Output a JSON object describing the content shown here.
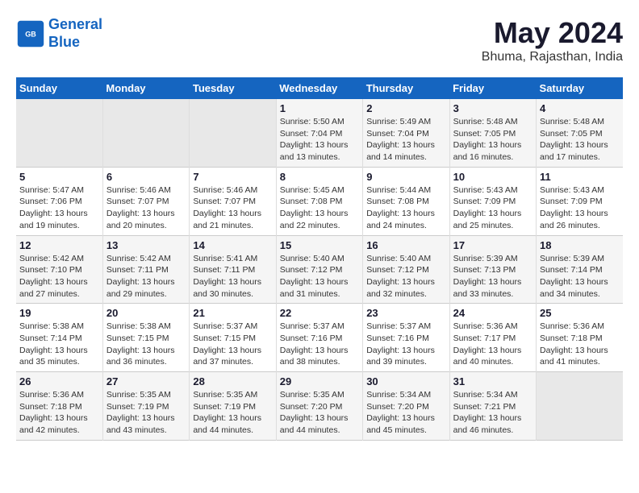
{
  "header": {
    "logo_line1": "General",
    "logo_line2": "Blue",
    "month_year": "May 2024",
    "location": "Bhuma, Rajasthan, India"
  },
  "weekdays": [
    "Sunday",
    "Monday",
    "Tuesday",
    "Wednesday",
    "Thursday",
    "Friday",
    "Saturday"
  ],
  "weeks": [
    [
      {
        "day": "",
        "empty": true
      },
      {
        "day": "",
        "empty": true
      },
      {
        "day": "",
        "empty": true
      },
      {
        "day": "1",
        "sunrise": "5:50 AM",
        "sunset": "7:04 PM",
        "daylight": "13 hours and 13 minutes."
      },
      {
        "day": "2",
        "sunrise": "5:49 AM",
        "sunset": "7:04 PM",
        "daylight": "13 hours and 14 minutes."
      },
      {
        "day": "3",
        "sunrise": "5:48 AM",
        "sunset": "7:05 PM",
        "daylight": "13 hours and 16 minutes."
      },
      {
        "day": "4",
        "sunrise": "5:48 AM",
        "sunset": "7:05 PM",
        "daylight": "13 hours and 17 minutes."
      }
    ],
    [
      {
        "day": "5",
        "sunrise": "5:47 AM",
        "sunset": "7:06 PM",
        "daylight": "13 hours and 19 minutes."
      },
      {
        "day": "6",
        "sunrise": "5:46 AM",
        "sunset": "7:07 PM",
        "daylight": "13 hours and 20 minutes."
      },
      {
        "day": "7",
        "sunrise": "5:46 AM",
        "sunset": "7:07 PM",
        "daylight": "13 hours and 21 minutes."
      },
      {
        "day": "8",
        "sunrise": "5:45 AM",
        "sunset": "7:08 PM",
        "daylight": "13 hours and 22 minutes."
      },
      {
        "day": "9",
        "sunrise": "5:44 AM",
        "sunset": "7:08 PM",
        "daylight": "13 hours and 24 minutes."
      },
      {
        "day": "10",
        "sunrise": "5:43 AM",
        "sunset": "7:09 PM",
        "daylight": "13 hours and 25 minutes."
      },
      {
        "day": "11",
        "sunrise": "5:43 AM",
        "sunset": "7:09 PM",
        "daylight": "13 hours and 26 minutes."
      }
    ],
    [
      {
        "day": "12",
        "sunrise": "5:42 AM",
        "sunset": "7:10 PM",
        "daylight": "13 hours and 27 minutes."
      },
      {
        "day": "13",
        "sunrise": "5:42 AM",
        "sunset": "7:11 PM",
        "daylight": "13 hours and 29 minutes."
      },
      {
        "day": "14",
        "sunrise": "5:41 AM",
        "sunset": "7:11 PM",
        "daylight": "13 hours and 30 minutes."
      },
      {
        "day": "15",
        "sunrise": "5:40 AM",
        "sunset": "7:12 PM",
        "daylight": "13 hours and 31 minutes."
      },
      {
        "day": "16",
        "sunrise": "5:40 AM",
        "sunset": "7:12 PM",
        "daylight": "13 hours and 32 minutes."
      },
      {
        "day": "17",
        "sunrise": "5:39 AM",
        "sunset": "7:13 PM",
        "daylight": "13 hours and 33 minutes."
      },
      {
        "day": "18",
        "sunrise": "5:39 AM",
        "sunset": "7:14 PM",
        "daylight": "13 hours and 34 minutes."
      }
    ],
    [
      {
        "day": "19",
        "sunrise": "5:38 AM",
        "sunset": "7:14 PM",
        "daylight": "13 hours and 35 minutes."
      },
      {
        "day": "20",
        "sunrise": "5:38 AM",
        "sunset": "7:15 PM",
        "daylight": "13 hours and 36 minutes."
      },
      {
        "day": "21",
        "sunrise": "5:37 AM",
        "sunset": "7:15 PM",
        "daylight": "13 hours and 37 minutes."
      },
      {
        "day": "22",
        "sunrise": "5:37 AM",
        "sunset": "7:16 PM",
        "daylight": "13 hours and 38 minutes."
      },
      {
        "day": "23",
        "sunrise": "5:37 AM",
        "sunset": "7:16 PM",
        "daylight": "13 hours and 39 minutes."
      },
      {
        "day": "24",
        "sunrise": "5:36 AM",
        "sunset": "7:17 PM",
        "daylight": "13 hours and 40 minutes."
      },
      {
        "day": "25",
        "sunrise": "5:36 AM",
        "sunset": "7:18 PM",
        "daylight": "13 hours and 41 minutes."
      }
    ],
    [
      {
        "day": "26",
        "sunrise": "5:36 AM",
        "sunset": "7:18 PM",
        "daylight": "13 hours and 42 minutes."
      },
      {
        "day": "27",
        "sunrise": "5:35 AM",
        "sunset": "7:19 PM",
        "daylight": "13 hours and 43 minutes."
      },
      {
        "day": "28",
        "sunrise": "5:35 AM",
        "sunset": "7:19 PM",
        "daylight": "13 hours and 44 minutes."
      },
      {
        "day": "29",
        "sunrise": "5:35 AM",
        "sunset": "7:20 PM",
        "daylight": "13 hours and 44 minutes."
      },
      {
        "day": "30",
        "sunrise": "5:34 AM",
        "sunset": "7:20 PM",
        "daylight": "13 hours and 45 minutes."
      },
      {
        "day": "31",
        "sunrise": "5:34 AM",
        "sunset": "7:21 PM",
        "daylight": "13 hours and 46 minutes."
      },
      {
        "day": "",
        "empty": true
      }
    ]
  ]
}
